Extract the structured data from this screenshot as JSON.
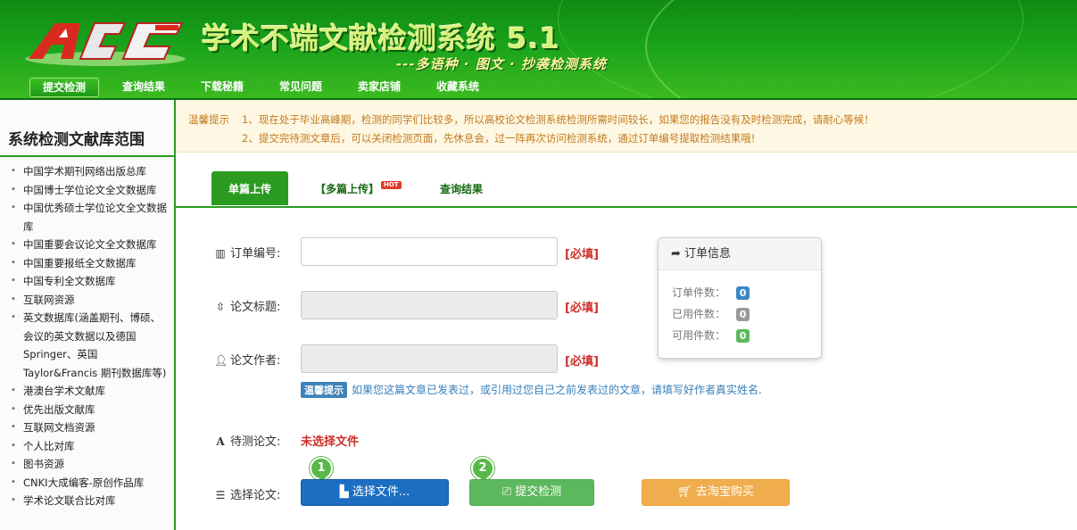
{
  "header": {
    "title": "学术不端文献检测系统 5.1",
    "subtitle": "---多语种 · 图文 · 抄袭检测系统",
    "nav": [
      "提交检测",
      "查询结果",
      "下载秘籍",
      "常见问题",
      "卖家店铺",
      "收藏系统"
    ]
  },
  "sidebar": {
    "title": "系统检测文献库范围",
    "items": [
      "中国学术期刊网络出版总库",
      "中国博士学位论文全文数据库",
      "中国优秀硕士学位论文全文数据库",
      "中国重要会议论文全文数据库",
      "中国重要报纸全文数据库",
      "中国专利全文数据库",
      "互联网资源",
      "英文数据库(涵盖期刊、博硕、会议的英文数据以及德国Springer、英国Taylor&Francis 期刊数据库等)",
      "港澳台学术文献库",
      "优先出版文献库",
      "互联网文档资源",
      "个人比对库",
      "图书资源",
      "CNKI大成编客-原创作品库",
      "学术论文联合比对库"
    ]
  },
  "notice": {
    "label": "温馨提示",
    "line1": "1、现在处于毕业高峰期，检测的同学们比较多，所以高校论文检测系统检测所需时间较长，如果您的报告没有及时检测完成，请耐心等候！",
    "line2": "2、提交完待测文章后，可以关闭检测页面，先休息会，过一阵再次访问检测系统，通过订单编号提取检测结果哦!"
  },
  "tabs": {
    "single": "单篇上传",
    "multi": "【多篇上传】",
    "hot": "HOT",
    "query": "查询结果"
  },
  "form": {
    "order_label": "订单编号:",
    "title_label": "论文标题:",
    "author_label": "论文作者:",
    "required": "[必填]",
    "tip_badge": "温馨提示",
    "tip_text": "如果您这篇文章已发表过，或引用过您自己之前发表过的文章，请填写好作者真实姓名.",
    "paper_label": "待测论文:",
    "no_file": "未选择文件",
    "select_label": "选择论文:",
    "choose_file": "选择文件...",
    "submit": "提交检测",
    "buy": "去淘宝购买",
    "step1": "1",
    "step2": "2"
  },
  "order_info": {
    "title": "订单信息",
    "rows": [
      {
        "label": "订单件数：",
        "value": "0",
        "color": "#3a87c6"
      },
      {
        "label": "已用件数：",
        "value": "0",
        "color": "#999999"
      },
      {
        "label": "可用件数：",
        "value": "0",
        "color": "#5cb85c"
      }
    ]
  }
}
